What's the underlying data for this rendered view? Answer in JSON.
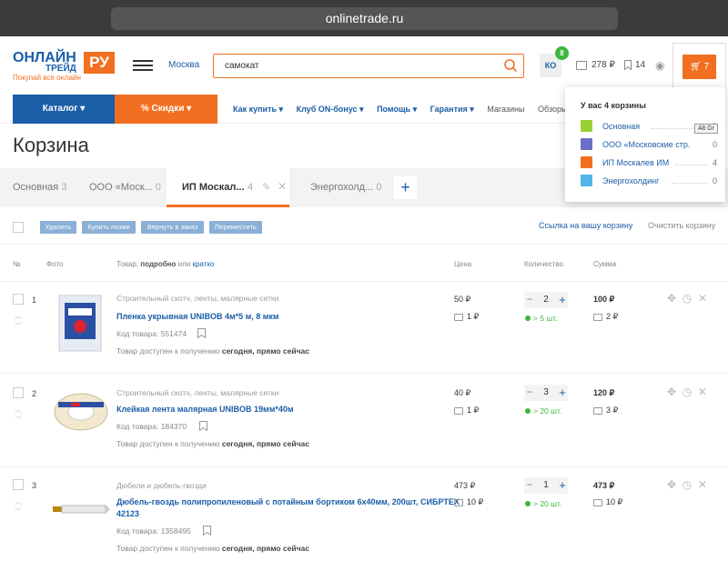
{
  "browser": {
    "url": "onlinetrade.ru"
  },
  "logo": {
    "line1": "ОНЛАЙН",
    "line2": "ТРЕЙД",
    "ru": "РУ",
    "tagline": "Покупай всё онлайн"
  },
  "header": {
    "city": "Москва",
    "search_value": "самокат",
    "user_initials": "КО",
    "user_badge": "8",
    "wallet": "278 ₽",
    "bookmarks": "14",
    "cart_count": "7"
  },
  "nav": {
    "catalog": "Каталог",
    "discounts": "Скидки",
    "links": [
      "Как купить",
      "Клуб ON-бонус",
      "Помощь",
      "Гарантия",
      "Магазины",
      "Обзоры"
    ]
  },
  "page_title": "Корзина",
  "tabs": [
    {
      "label": "Основная",
      "count": "3"
    },
    {
      "label": "ООО «Моск...",
      "count": "0"
    },
    {
      "label": "ИП Москал...",
      "count": "4"
    },
    {
      "label": "Энергохолд...",
      "count": "0"
    }
  ],
  "actions": {
    "delete": "Удалить",
    "buy_later": "Купить позже",
    "return": "Вернуть в заказ",
    "move": "Переместить",
    "share_link": "Ссылка на вашу корзину",
    "clear": "Очистить корзину"
  },
  "columns": {
    "num": "№",
    "photo": "Фото",
    "product_prefix": "Товар,",
    "detailed": "подробно",
    "or": "или",
    "brief": "кратко",
    "price": "Цена",
    "quantity": "Количество",
    "sum": "Сумма"
  },
  "code_label": "Код товара:",
  "availability_label": "Товар доступен к получению",
  "availability_value": "сегодня, прямо сейчас",
  "items": [
    {
      "n": "1",
      "category": "Строительный скотч, ленты, малярные сетки",
      "name": "Пленка укрывная UNIBOB 4м*5 м, 8 мкм",
      "code": "551474",
      "price": "50 ₽",
      "bonus": "1 ₽",
      "qty": "2",
      "stock": "> 5 шт.",
      "sum": "100 ₽",
      "sum_bonus": "2 ₽"
    },
    {
      "n": "2",
      "category": "Строительный скотч, ленты, малярные сетки",
      "name": "Клейкая лента малярная UNIBOB 19мм*40м",
      "code": "184370",
      "price": "40 ₽",
      "bonus": "1 ₽",
      "qty": "3",
      "stock": "> 20 шт.",
      "sum": "120 ₽",
      "sum_bonus": "3 ₽"
    },
    {
      "n": "3",
      "category": "Дюбели и дюбель-гвозди",
      "name1": "Дюбель-гвоздь полипропиленовый с потайным бортиком 6х40мм, 200шт, СИБРТЕХ",
      "name2": "42123",
      "code": "1358495",
      "price": "473 ₽",
      "bonus": "10 ₽",
      "qty": "1",
      "stock": "> 20 шт.",
      "sum": "473 ₽",
      "sum_bonus": "10 ₽"
    }
  ],
  "dropdown": {
    "title": "У вас 4 корзины",
    "carts": [
      {
        "label": "Основная",
        "count": "3",
        "color": "#9bd035"
      },
      {
        "label": "ООО «Московские стр...",
        "count": "0",
        "color": "#6a6fc8"
      },
      {
        "label": "ИП Москалев ИМ",
        "count": "4",
        "color": "#f26f21"
      },
      {
        "label": "Энергохолдинг",
        "count": "0",
        "color": "#4fb6e8"
      }
    ],
    "tooltip": "Alt Gr"
  },
  "colors": {
    "brand_blue": "#1b5ea8",
    "brand_orange": "#f26f21",
    "stock_green": "#3cb63c"
  }
}
